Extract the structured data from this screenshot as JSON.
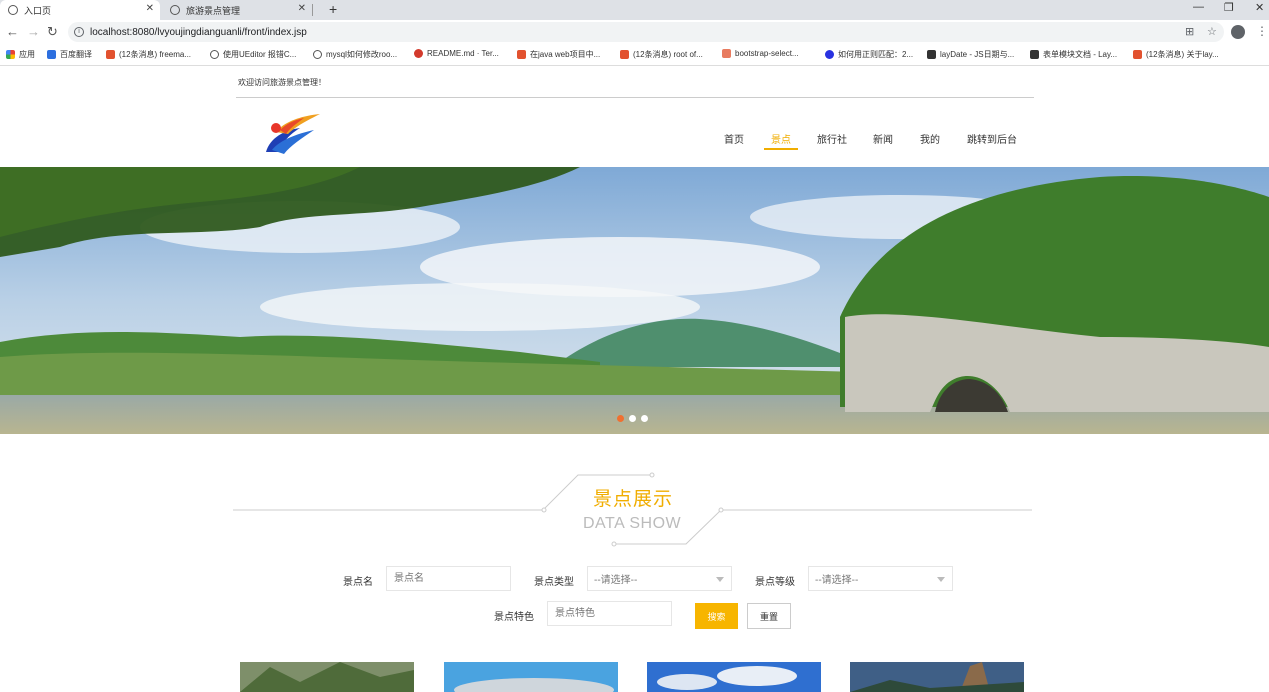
{
  "browser": {
    "tabs": [
      {
        "label": "入口页",
        "active": true
      },
      {
        "label": "旅游景点管理",
        "active": false
      }
    ],
    "new_tab": "+",
    "window_controls": {
      "minimize": "—",
      "restore": "❐",
      "close": "✕"
    },
    "url": "localhost:8080/lvyoujingdianguanli/front/index.jsp",
    "bookmarks": [
      {
        "label": "应用",
        "color": "#e94235"
      },
      {
        "label": "百度翻译",
        "color": "#2d6fdf"
      },
      {
        "label": "(12条消息) freema...",
        "color": "#e2522f"
      },
      {
        "label": "使用UEditor 报错C...",
        "color": "#555555"
      },
      {
        "label": "mysql如何修改roo...",
        "color": "#555555"
      },
      {
        "label": "README.md · Ter...",
        "color": "#d33a2c"
      },
      {
        "label": "在java web项目中...",
        "color": "#e2522f"
      },
      {
        "label": "(12条消息) root of...",
        "color": "#e2522f"
      },
      {
        "label": "bootstrap-select...",
        "color": "#e87b5f"
      },
      {
        "label": "如何用正则匹配：2...",
        "color": "#2932e1"
      },
      {
        "label": "layDate - JS日期与...",
        "color": "#333333"
      },
      {
        "label": "表单模块文档 - Lay...",
        "color": "#333333"
      },
      {
        "label": "(12条消息) 关于lay...",
        "color": "#e2522f"
      }
    ]
  },
  "header": {
    "welcome": "欢迎访问旅游景点管理！",
    "nav": [
      {
        "label": "首页",
        "active": false
      },
      {
        "label": "景点",
        "active": true
      },
      {
        "label": "旅行社",
        "active": false
      },
      {
        "label": "新闻",
        "active": false
      },
      {
        "label": "我的",
        "active": false
      },
      {
        "label": "跳转到后台",
        "active": false
      }
    ]
  },
  "carousel": {
    "slide_count": 3,
    "active_index": 0
  },
  "section": {
    "title": "景点展示",
    "subtitle": "DATA SHOW"
  },
  "search": {
    "name_label": "景点名",
    "name_placeholder": "景点名",
    "type_label": "景点类型",
    "type_value": "--请选择--",
    "level_label": "景点等级",
    "level_value": "--请选择--",
    "feature_label": "景点特色",
    "feature_placeholder": "景点特色",
    "search_button": "搜索",
    "reset_button": "重置"
  },
  "colors": {
    "accent": "#f0ad00",
    "button": "#f7b500",
    "dot_active": "#f07030"
  }
}
